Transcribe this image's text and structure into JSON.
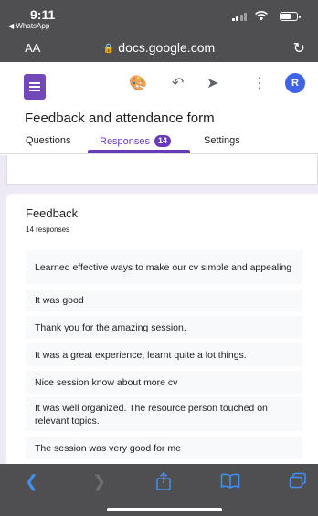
{
  "status_bar": {
    "time": "9:11",
    "back_app": "◀ WhatsApp"
  },
  "browser": {
    "text_size_label": "AA",
    "url": "docs.google.com"
  },
  "header": {
    "avatar_initial": "R"
  },
  "form": {
    "title": "Feedback and attendance form",
    "tabs": [
      {
        "label": "Questions",
        "active": false
      },
      {
        "label": "Responses",
        "active": true,
        "badge": "14"
      },
      {
        "label": "Settings",
        "active": false
      }
    ]
  },
  "question": {
    "title": "Feedback",
    "count_label": "14 responses",
    "responses": [
      "Learned effective ways to make our cv simple and appealing",
      "It was good",
      "Thank you for the amazing session.",
      "It was a great experience, learnt quite a lot things.",
      "Nice session know about more cv",
      "It was well organized. The resource person touched on relevant topics.",
      "The session was very good for me"
    ]
  },
  "colors": {
    "accent": "#673ab7",
    "forms_logo": "#7248b9",
    "avatar": "#3f63e8",
    "page_bg": "#eeeaf5",
    "browser_chrome": "#4f4f52",
    "safari_blue": "#3e8ff0"
  },
  "icons": [
    "lock-icon",
    "reload-icon",
    "palette-icon",
    "undo-icon",
    "send-icon",
    "more-vert-icon",
    "back-icon",
    "forward-icon",
    "share-icon",
    "bookmarks-icon",
    "tabs-icon"
  ]
}
